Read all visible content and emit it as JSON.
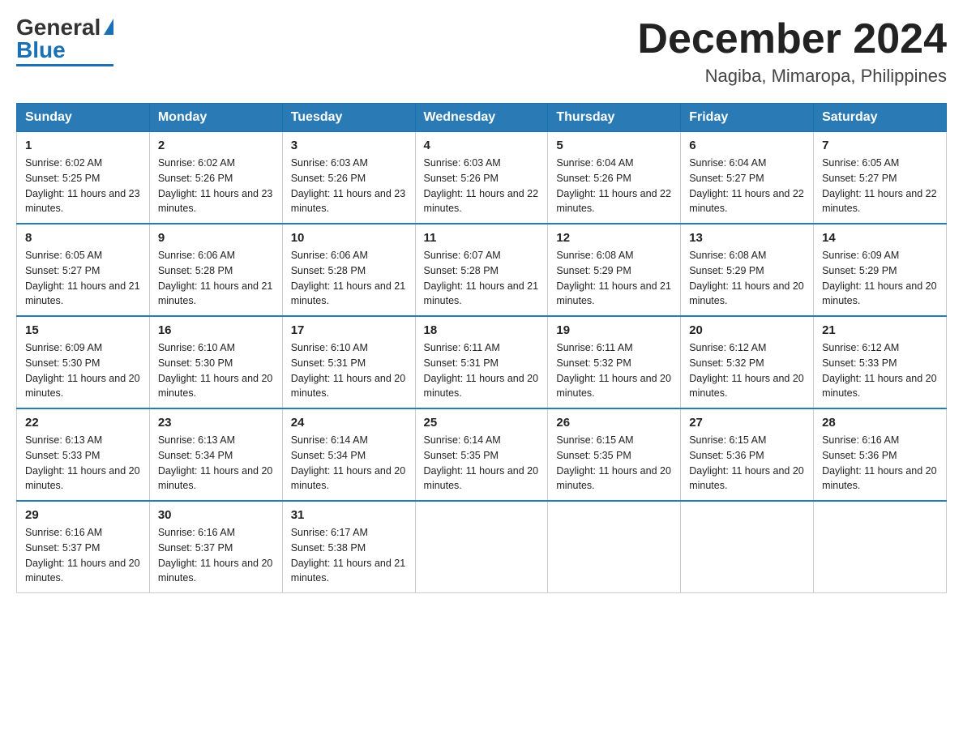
{
  "logo": {
    "general": "General",
    "blue": "Blue"
  },
  "title": "December 2024",
  "location": "Nagiba, Mimaropa, Philippines",
  "headers": [
    "Sunday",
    "Monday",
    "Tuesday",
    "Wednesday",
    "Thursday",
    "Friday",
    "Saturday"
  ],
  "weeks": [
    [
      {
        "day": "1",
        "sunrise": "6:02 AM",
        "sunset": "5:25 PM",
        "daylight": "11 hours and 23 minutes."
      },
      {
        "day": "2",
        "sunrise": "6:02 AM",
        "sunset": "5:26 PM",
        "daylight": "11 hours and 23 minutes."
      },
      {
        "day": "3",
        "sunrise": "6:03 AM",
        "sunset": "5:26 PM",
        "daylight": "11 hours and 23 minutes."
      },
      {
        "day": "4",
        "sunrise": "6:03 AM",
        "sunset": "5:26 PM",
        "daylight": "11 hours and 22 minutes."
      },
      {
        "day": "5",
        "sunrise": "6:04 AM",
        "sunset": "5:26 PM",
        "daylight": "11 hours and 22 minutes."
      },
      {
        "day": "6",
        "sunrise": "6:04 AM",
        "sunset": "5:27 PM",
        "daylight": "11 hours and 22 minutes."
      },
      {
        "day": "7",
        "sunrise": "6:05 AM",
        "sunset": "5:27 PM",
        "daylight": "11 hours and 22 minutes."
      }
    ],
    [
      {
        "day": "8",
        "sunrise": "6:05 AM",
        "sunset": "5:27 PM",
        "daylight": "11 hours and 21 minutes."
      },
      {
        "day": "9",
        "sunrise": "6:06 AM",
        "sunset": "5:28 PM",
        "daylight": "11 hours and 21 minutes."
      },
      {
        "day": "10",
        "sunrise": "6:06 AM",
        "sunset": "5:28 PM",
        "daylight": "11 hours and 21 minutes."
      },
      {
        "day": "11",
        "sunrise": "6:07 AM",
        "sunset": "5:28 PM",
        "daylight": "11 hours and 21 minutes."
      },
      {
        "day": "12",
        "sunrise": "6:08 AM",
        "sunset": "5:29 PM",
        "daylight": "11 hours and 21 minutes."
      },
      {
        "day": "13",
        "sunrise": "6:08 AM",
        "sunset": "5:29 PM",
        "daylight": "11 hours and 20 minutes."
      },
      {
        "day": "14",
        "sunrise": "6:09 AM",
        "sunset": "5:29 PM",
        "daylight": "11 hours and 20 minutes."
      }
    ],
    [
      {
        "day": "15",
        "sunrise": "6:09 AM",
        "sunset": "5:30 PM",
        "daylight": "11 hours and 20 minutes."
      },
      {
        "day": "16",
        "sunrise": "6:10 AM",
        "sunset": "5:30 PM",
        "daylight": "11 hours and 20 minutes."
      },
      {
        "day": "17",
        "sunrise": "6:10 AM",
        "sunset": "5:31 PM",
        "daylight": "11 hours and 20 minutes."
      },
      {
        "day": "18",
        "sunrise": "6:11 AM",
        "sunset": "5:31 PM",
        "daylight": "11 hours and 20 minutes."
      },
      {
        "day": "19",
        "sunrise": "6:11 AM",
        "sunset": "5:32 PM",
        "daylight": "11 hours and 20 minutes."
      },
      {
        "day": "20",
        "sunrise": "6:12 AM",
        "sunset": "5:32 PM",
        "daylight": "11 hours and 20 minutes."
      },
      {
        "day": "21",
        "sunrise": "6:12 AM",
        "sunset": "5:33 PM",
        "daylight": "11 hours and 20 minutes."
      }
    ],
    [
      {
        "day": "22",
        "sunrise": "6:13 AM",
        "sunset": "5:33 PM",
        "daylight": "11 hours and 20 minutes."
      },
      {
        "day": "23",
        "sunrise": "6:13 AM",
        "sunset": "5:34 PM",
        "daylight": "11 hours and 20 minutes."
      },
      {
        "day": "24",
        "sunrise": "6:14 AM",
        "sunset": "5:34 PM",
        "daylight": "11 hours and 20 minutes."
      },
      {
        "day": "25",
        "sunrise": "6:14 AM",
        "sunset": "5:35 PM",
        "daylight": "11 hours and 20 minutes."
      },
      {
        "day": "26",
        "sunrise": "6:15 AM",
        "sunset": "5:35 PM",
        "daylight": "11 hours and 20 minutes."
      },
      {
        "day": "27",
        "sunrise": "6:15 AM",
        "sunset": "5:36 PM",
        "daylight": "11 hours and 20 minutes."
      },
      {
        "day": "28",
        "sunrise": "6:16 AM",
        "sunset": "5:36 PM",
        "daylight": "11 hours and 20 minutes."
      }
    ],
    [
      {
        "day": "29",
        "sunrise": "6:16 AM",
        "sunset": "5:37 PM",
        "daylight": "11 hours and 20 minutes."
      },
      {
        "day": "30",
        "sunrise": "6:16 AM",
        "sunset": "5:37 PM",
        "daylight": "11 hours and 20 minutes."
      },
      {
        "day": "31",
        "sunrise": "6:17 AM",
        "sunset": "5:38 PM",
        "daylight": "11 hours and 21 minutes."
      },
      null,
      null,
      null,
      null
    ]
  ],
  "colors": {
    "header_bg": "#2a7ab5",
    "header_text": "#ffffff",
    "border": "#aaaaaa",
    "row_divider": "#2a7ab5"
  }
}
